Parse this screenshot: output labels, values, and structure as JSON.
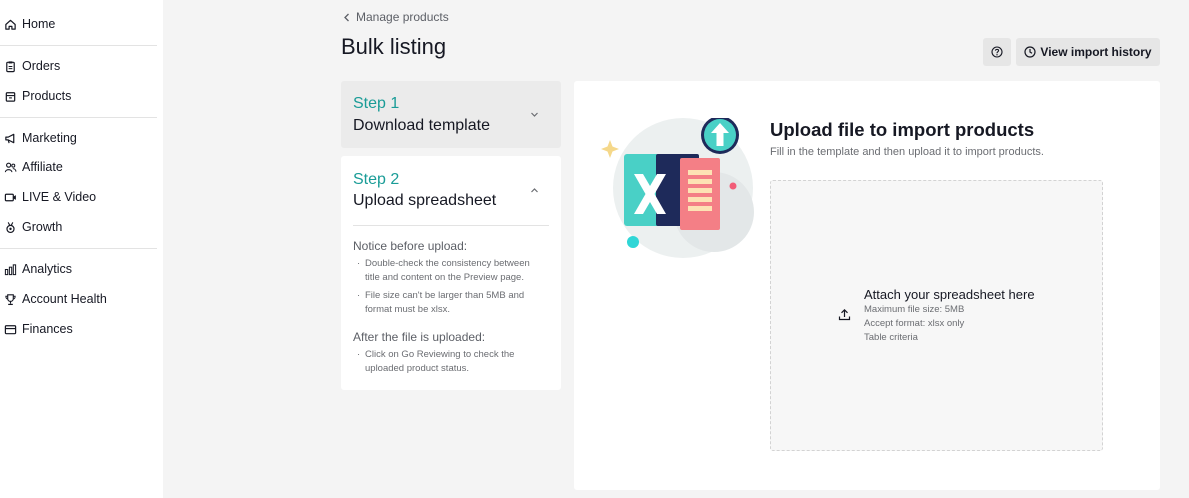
{
  "sidebar": {
    "items": [
      {
        "label": "Home",
        "icon": "home-icon"
      },
      {
        "label": "Orders",
        "icon": "clipboard-icon"
      },
      {
        "label": "Products",
        "icon": "box-icon"
      },
      {
        "label": "Marketing",
        "icon": "megaphone-icon"
      },
      {
        "label": "Affiliate",
        "icon": "people-icon"
      },
      {
        "label": "LIVE & Video",
        "icon": "video-icon"
      },
      {
        "label": "Growth",
        "icon": "medal-icon"
      },
      {
        "label": "Analytics",
        "icon": "bar-chart-icon"
      },
      {
        "label": "Account Health",
        "icon": "trophy-icon"
      },
      {
        "label": "Finances",
        "icon": "card-icon"
      }
    ]
  },
  "header": {
    "breadcrumb": "Manage products",
    "title": "Bulk listing",
    "history_button": "View import history"
  },
  "steps": {
    "step1": {
      "number": "Step 1",
      "name": "Download template"
    },
    "step2": {
      "number": "Step 2",
      "name": "Upload spreadsheet",
      "notice_heading": "Notice before upload:",
      "notice_items": [
        "Double-check the consistency between title and content on the Preview page.",
        "File size can't be larger than 5MB and format must be xlsx."
      ],
      "after_heading": "After the file is uploaded:",
      "after_items": [
        "Click on Go Reviewing to check the uploaded product status."
      ]
    }
  },
  "upload": {
    "title": "Upload file to import products",
    "subtitle": "Fill in the template and then upload it to import products.",
    "dropzone": {
      "title": "Attach your spreadsheet here",
      "max_size": "Maximum file size: 5MB",
      "format": "Accept format: xlsx only",
      "criteria": "Table criteria"
    }
  },
  "colors": {
    "accent_teal": "#1a9c97",
    "background": "#f4f4f4",
    "excel_navy": "#1e2a5a",
    "excel_teal": "#49d0c6",
    "excel_pink": "#f47f86"
  }
}
